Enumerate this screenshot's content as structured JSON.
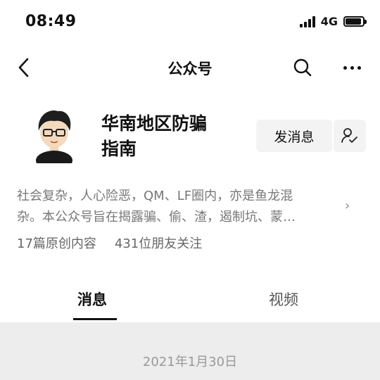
{
  "status_bar": {
    "time": "08:49",
    "network": "4G"
  },
  "nav": {
    "title": "公众号"
  },
  "account": {
    "name_line1": "华南地区防骗",
    "name_line2": "指南",
    "message_button": "发消息",
    "description_line1": "社会复杂，人心险恶，QM、LF圈内，亦是鱼龙混",
    "description_line2": "杂。本公众号旨在揭露骗、偷、渣，遏制坑、蒙…",
    "original_count": "17篇原创内容",
    "followers": "431位朋友关注"
  },
  "tabs": {
    "messages": "消息",
    "videos": "视频"
  },
  "feed": {
    "date": "2021年1月30日"
  },
  "icons": {
    "back": "chevron-left-icon",
    "search": "search-icon",
    "more": "more-icon",
    "follow": "user-check-icon",
    "expand": "chevron-right-icon"
  }
}
